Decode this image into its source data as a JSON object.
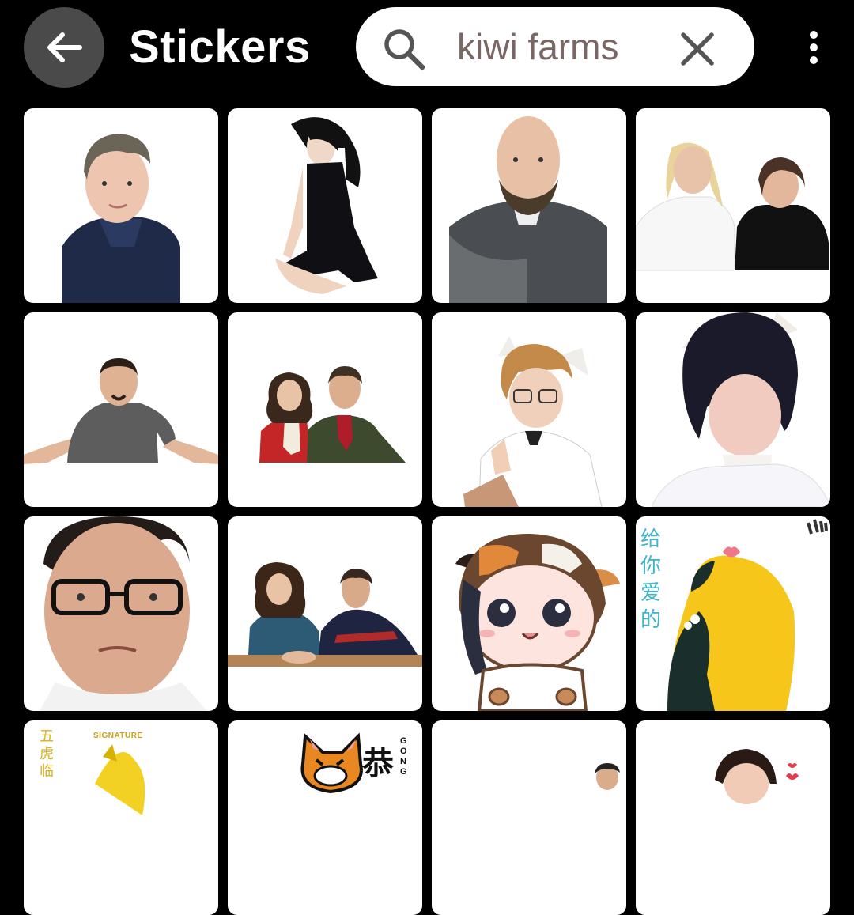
{
  "header": {
    "title": "Stickers",
    "back_icon": "arrow-left-icon",
    "more_icon": "more-vertical-icon"
  },
  "search": {
    "value": "kiwi farms",
    "search_icon": "search-icon",
    "clear_icon": "close-icon"
  },
  "stickers": [
    {
      "label": "sticker-short-hair-blue-coat"
    },
    {
      "label": "sticker-woman-black-dress"
    },
    {
      "label": "sticker-bald-man-jacket"
    },
    {
      "label": "sticker-two-women"
    },
    {
      "label": "sticker-man-shrug"
    },
    {
      "label": "sticker-couple-red-green"
    },
    {
      "label": "sticker-cat-ears-maid"
    },
    {
      "label": "sticker-cat-ears-dark-hair"
    },
    {
      "label": "sticker-man-glasses"
    },
    {
      "label": "sticker-couple-at-table"
    },
    {
      "label": "sticker-cartoon-cow-hood"
    },
    {
      "label": "sticker-yellow-chick"
    },
    {
      "label": "sticker-signature-yellow"
    },
    {
      "label": "sticker-tiger-gong"
    },
    {
      "label": "sticker-partial-person"
    },
    {
      "label": "sticker-woman-hearts"
    }
  ],
  "sticker_text": {
    "chick_chars": [
      "给",
      "你",
      "爱",
      "的"
    ],
    "signature_brand": "SIGNATURE",
    "signature_chars": [
      "五",
      "虎",
      "临"
    ],
    "tiger_char": "恭",
    "tiger_latin": [
      "G",
      "O",
      "N",
      "G"
    ]
  },
  "colors": {
    "background": "#000000",
    "back_button": "#4a4a4a",
    "search_text": "#7a6664",
    "tile_bg": "#ffffff",
    "chick_text": "#3fb6c8",
    "chick_yellow": "#f7c61a"
  }
}
